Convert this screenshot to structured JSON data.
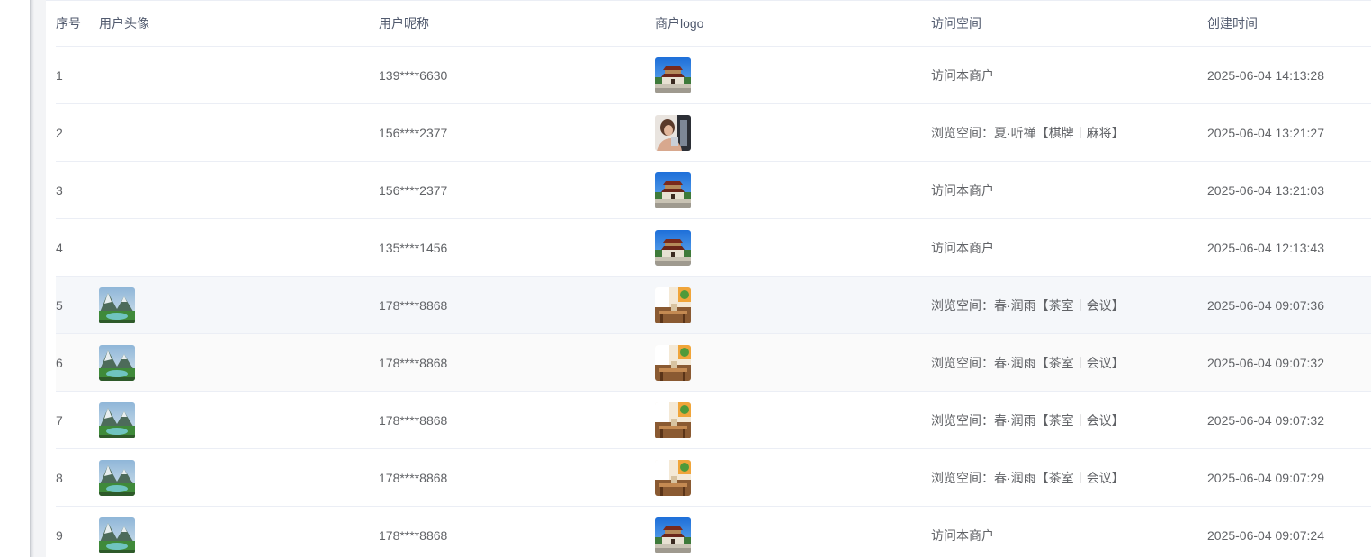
{
  "table": {
    "columns": {
      "seq": "序号",
      "avatar": "用户头像",
      "nickname": "用户昵称",
      "logo": "商户logo",
      "space": "访问空间",
      "time": "创建时间"
    },
    "rows": [
      {
        "seq": "1",
        "avatar": "",
        "nickname": "139****6630",
        "logo": "gate-icon",
        "space": "访问本商户",
        "time": "2025-06-04 14:13:28"
      },
      {
        "seq": "2",
        "avatar": "",
        "nickname": "156****2377",
        "logo": "portrait-photo-icon",
        "space": "浏览空间：夏·听禅【棋牌丨麻将】",
        "time": "2025-06-04 13:21:27"
      },
      {
        "seq": "3",
        "avatar": "",
        "nickname": "156****2377",
        "logo": "gate-icon",
        "space": "访问本商户",
        "time": "2025-06-04 13:21:03"
      },
      {
        "seq": "4",
        "avatar": "",
        "nickname": "135****1456",
        "logo": "gate-icon",
        "space": "访问本商户",
        "time": "2025-06-04 12:13:43"
      },
      {
        "seq": "5",
        "avatar": "mountain-lake-icon",
        "nickname": "178****8868",
        "logo": "tearoom-icon",
        "space": "浏览空间：春·润雨【茶室丨会议】",
        "time": "2025-06-04 09:07:36"
      },
      {
        "seq": "6",
        "avatar": "mountain-lake-icon",
        "nickname": "178****8868",
        "logo": "tearoom-icon",
        "space": "浏览空间：春·润雨【茶室丨会议】",
        "time": "2025-06-04 09:07:32"
      },
      {
        "seq": "7",
        "avatar": "mountain-lake-icon",
        "nickname": "178****8868",
        "logo": "tearoom-icon",
        "space": "浏览空间：春·润雨【茶室丨会议】",
        "time": "2025-06-04 09:07:32"
      },
      {
        "seq": "8",
        "avatar": "mountain-lake-icon",
        "nickname": "178****8868",
        "logo": "tearoom-icon",
        "space": "浏览空间：春·润雨【茶室丨会议】",
        "time": "2025-06-04 09:07:29"
      },
      {
        "seq": "9",
        "avatar": "mountain-lake-icon",
        "nickname": "178****8868",
        "logo": "gate-icon",
        "space": "访问本商户",
        "time": "2025-06-04 09:07:24"
      }
    ]
  },
  "colors": {
    "header_text": "#515a6e",
    "body_text": "#606266",
    "row_border": "#ebeef5",
    "hover_row": "#f5f7fa"
  }
}
